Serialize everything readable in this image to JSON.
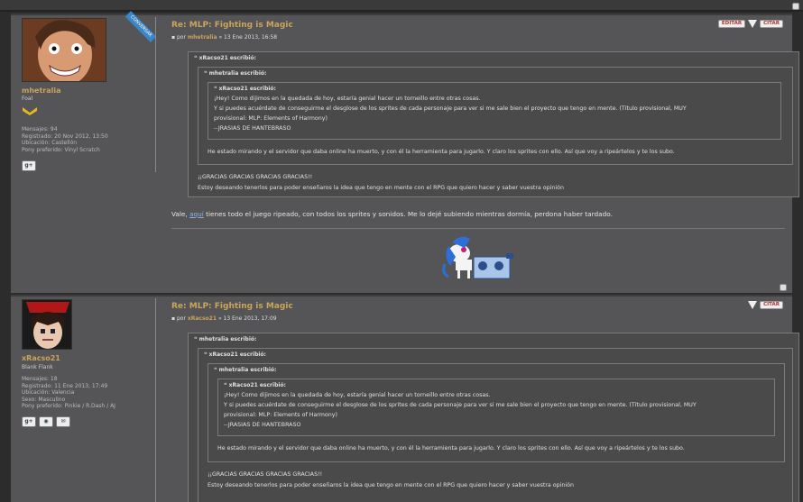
{
  "posts": [
    {
      "author": {
        "name": "mhetralia",
        "rank": "Foal",
        "badge": "CONVERSAR",
        "stats": [
          "Mensajes: 94",
          "Registrado: 20 Nov 2012, 13:50",
          "Ubicación: Castellón",
          "Pony preferido: Vinyl Scratch"
        ]
      },
      "title": "Re: MLP: Fighting is Magic",
      "meta_prefix": "por",
      "meta_author": "mhetralia",
      "meta_date": "» 13 Ene 2013, 16:58",
      "edit_label": "EDITAR",
      "quote_label": "CITAR",
      "quotes": {
        "outer_head": "xRacso21 escribió:",
        "mid_head": "mhetralia escribió:",
        "inner_head": "xRacso21 escribió:",
        "inner_lines": [
          "¡Hey! Como dijimos en la quedada de hoy, estaría genial hacer un torneillo entre otras cosas.",
          "Y si puedes acuérdate de conseguirme el desglose de los sprites de cada personaje para ver si me sale bien el proyecto que tengo en mente. (Título provisional, MUY",
          "provisional: MLP: Elements of Harmony)",
          "--JRASIAS DE HANTEBRASO"
        ],
        "mid_text": "He estado mirando y el servidor que daba online ha muerto, y con él la herramienta para jugarlo. Y claro los sprites con ello. Así que voy a ripeártelos y te los subo.",
        "outer_lines": [
          "¡¡GRACIAS GRACIAS GRACIAS GRACIAS!!",
          "Estoy deseando tenerlos para poder enseñaros la idea que tengo en mente con el RPG que quiero hacer y saber vuestra opinión"
        ]
      },
      "message_pre": "Vale,",
      "message_link": "aquí",
      "message_post": "tienes todo el juego ripeado, con todos los sprites y sonidos. Me lo dejé subiendo mientras dormía, perdona haber tardado."
    },
    {
      "author": {
        "name": "xRacso21",
        "rank": "Blank Flank",
        "stats": [
          "Mensajes: 18",
          "Registrado: 11 Ene 2013, 17:49",
          "Ubicación: Valencia",
          "Sexo: Masculino",
          "Pony preferido: Pinkie / R.Dash / AJ"
        ]
      },
      "title": "Re: MLP: Fighting is Magic",
      "meta_prefix": "por",
      "meta_author": "xRacso21",
      "meta_date": "» 13 Ene 2013, 17:09",
      "quote_label": "CITAR",
      "quotes": {
        "l1_head": "mhetralia escribió:",
        "l2_head": "xRacso21 escribió:",
        "l3_head": "mhetralia escribió:",
        "l4_head": "xRacso21 escribió:",
        "inner_lines": [
          "¡Hey! Como dijimos en la quedada de hoy, estaría genial hacer un torneillo entre otras cosas.",
          "Y si puedes acuérdate de conseguirme el desglose de los sprites de cada personaje para ver si me sale bien el proyecto que tengo en mente. (Título provisional, MUY",
          "provisional: MLP: Elements of Harmony)",
          "--JRASIAS DE HANTEBRASO"
        ],
        "l3_text": "He estado mirando y el servidor que daba online ha muerto, y con él la herramienta para jugarlo. Y claro los sprites con ello. Así que voy a ripeártelos y te los subo.",
        "l2_lines": [
          "¡¡GRACIAS GRACIAS GRACIAS GRACIAS!!",
          "Estoy deseando tenerlos para poder enseñaros la idea que tengo en mente con el RPG que quiero hacer y saber vuestra opinión"
        ]
      }
    }
  ],
  "icons": {
    "social1": "g+",
    "social2": "◉",
    "social3": "✉"
  }
}
